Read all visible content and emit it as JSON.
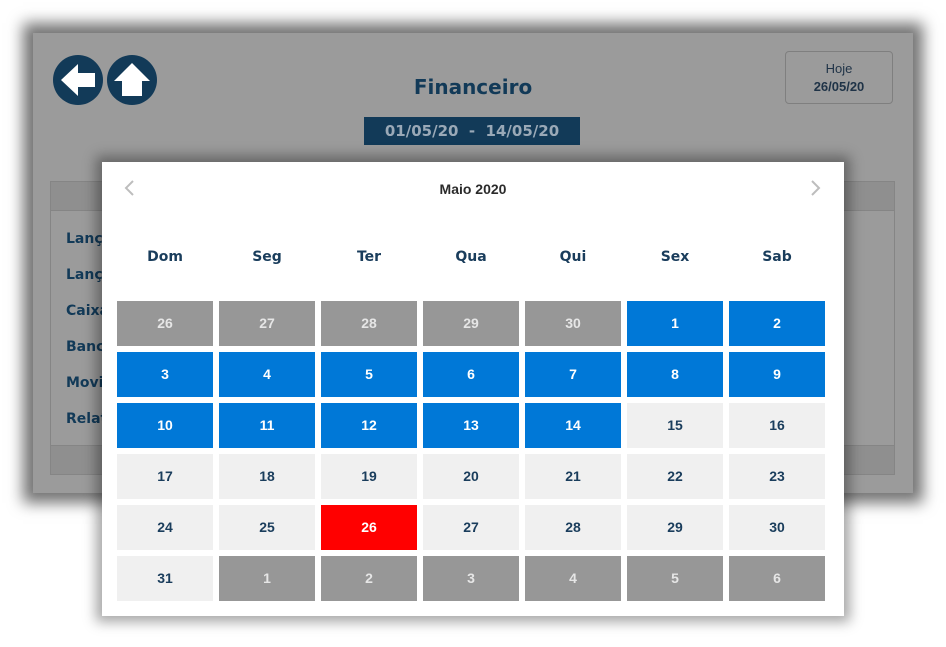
{
  "app": {
    "title": "Financeiro",
    "date_range": "01/05/20  -  14/05/20",
    "today_label": "Hoje",
    "today_date": "26/05/20",
    "menu_items": [
      "Lanç",
      "Lanç",
      "Caixa",
      "Banc",
      "Movi",
      "Relat"
    ],
    "colors": {
      "primary": "#123a58",
      "overlay_bg": "#9b9b9b"
    }
  },
  "calendar": {
    "title": "Maio 2020",
    "weekdays": [
      "Dom",
      "Seg",
      "Ter",
      "Qua",
      "Qui",
      "Sex",
      "Sab"
    ],
    "weeks": [
      [
        [
          "26",
          "other"
        ],
        [
          "27",
          "other"
        ],
        [
          "28",
          "other"
        ],
        [
          "29",
          "other"
        ],
        [
          "30",
          "other"
        ],
        [
          "1",
          "inrange"
        ],
        [
          "2",
          "inrange"
        ]
      ],
      [
        [
          "3",
          "inrange"
        ],
        [
          "4",
          "inrange"
        ],
        [
          "5",
          "inrange"
        ],
        [
          "6",
          "inrange"
        ],
        [
          "7",
          "inrange"
        ],
        [
          "8",
          "inrange"
        ],
        [
          "9",
          "inrange"
        ]
      ],
      [
        [
          "10",
          "inrange"
        ],
        [
          "11",
          "inrange"
        ],
        [
          "12",
          "inrange"
        ],
        [
          "13",
          "inrange"
        ],
        [
          "14",
          "inrange"
        ],
        [
          "15",
          "normal"
        ],
        [
          "16",
          "normal"
        ]
      ],
      [
        [
          "17",
          "normal"
        ],
        [
          "18",
          "normal"
        ],
        [
          "19",
          "normal"
        ],
        [
          "20",
          "normal"
        ],
        [
          "21",
          "normal"
        ],
        [
          "22",
          "normal"
        ],
        [
          "23",
          "normal"
        ]
      ],
      [
        [
          "24",
          "normal"
        ],
        [
          "25",
          "normal"
        ],
        [
          "26",
          "today"
        ],
        [
          "27",
          "normal"
        ],
        [
          "28",
          "normal"
        ],
        [
          "29",
          "normal"
        ],
        [
          "30",
          "normal"
        ]
      ],
      [
        [
          "31",
          "normal"
        ],
        [
          "1",
          "other"
        ],
        [
          "2",
          "other"
        ],
        [
          "3",
          "other"
        ],
        [
          "4",
          "other"
        ],
        [
          "5",
          "other"
        ],
        [
          "6",
          "other"
        ]
      ]
    ],
    "colors": {
      "in_range": "#0078d7",
      "today": "#ff0000",
      "other_month": "#979797",
      "normal": "#f0f0f0"
    },
    "icons": {
      "prev": "chevron-left-icon",
      "next": "chevron-right-icon"
    }
  }
}
